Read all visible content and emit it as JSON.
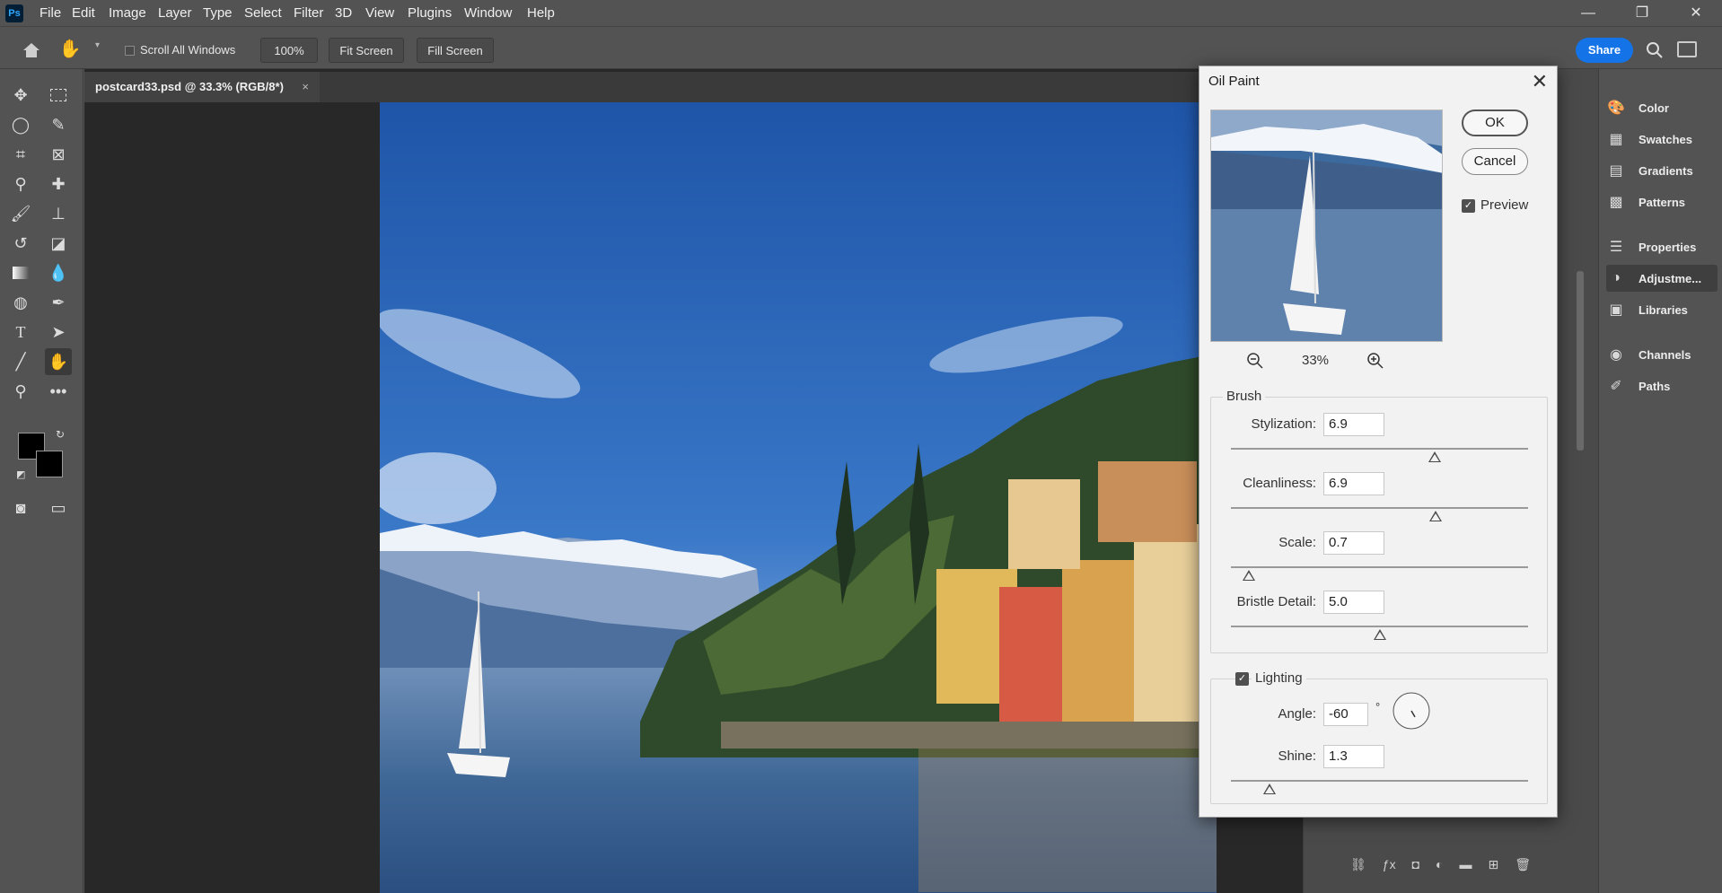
{
  "app": {
    "logo": "Ps",
    "menu": [
      "File",
      "Edit",
      "Image",
      "Layer",
      "Type",
      "Select",
      "Filter",
      "3D",
      "View",
      "Plugins",
      "Window",
      "Help"
    ]
  },
  "window_controls": {
    "minimize": "—",
    "restore": "❐",
    "close": "✕"
  },
  "options_bar": {
    "scroll_all_windows": "Scroll All Windows",
    "zoom_100": "100%",
    "fit_screen": "Fit Screen",
    "fill_screen": "Fill Screen",
    "share": "Share"
  },
  "document": {
    "tab_title": "postcard33.psd @ 33.3% (RGB/8*)",
    "tab_close": "×"
  },
  "panels": [
    {
      "label": "Color",
      "icon": "color-icon"
    },
    {
      "label": "Swatches",
      "icon": "swatches-icon"
    },
    {
      "label": "Gradients",
      "icon": "gradients-icon"
    },
    {
      "label": "Patterns",
      "icon": "patterns-icon"
    },
    {
      "label": "Properties",
      "icon": "properties-icon"
    },
    {
      "label": "Adjustme...",
      "icon": "adjustments-icon"
    },
    {
      "label": "Libraries",
      "icon": "libraries-icon"
    },
    {
      "label": "Channels",
      "icon": "channels-icon"
    },
    {
      "label": "Paths",
      "icon": "paths-icon"
    }
  ],
  "dialog": {
    "title": "Oil Paint",
    "ok": "OK",
    "cancel": "Cancel",
    "preview_label": "Preview",
    "preview_checked": true,
    "zoom_level": "33%",
    "brush": {
      "legend": "Brush",
      "stylization": {
        "label": "Stylization:",
        "value": "6.9",
        "min": 0.1,
        "max": 10
      },
      "cleanliness": {
        "label": "Cleanliness:",
        "value": "6.9",
        "min": 0,
        "max": 10
      },
      "scale": {
        "label": "Scale:",
        "value": "0.7",
        "min": 0.1,
        "max": 10
      },
      "bristle_detail": {
        "label": "Bristle Detail:",
        "value": "5.0",
        "min": 0,
        "max": 10
      }
    },
    "lighting": {
      "legend": "Lighting",
      "checked": true,
      "angle": {
        "label": "Angle:",
        "value": "-60",
        "unit": "°"
      },
      "shine": {
        "label": "Shine:",
        "value": "1.3",
        "min": 0,
        "max": 10
      }
    }
  },
  "colors": {
    "accent": "#1473e6",
    "chrome": "#535353",
    "canvas_bg": "#282828",
    "dialog_bg": "#f2f2f2"
  }
}
